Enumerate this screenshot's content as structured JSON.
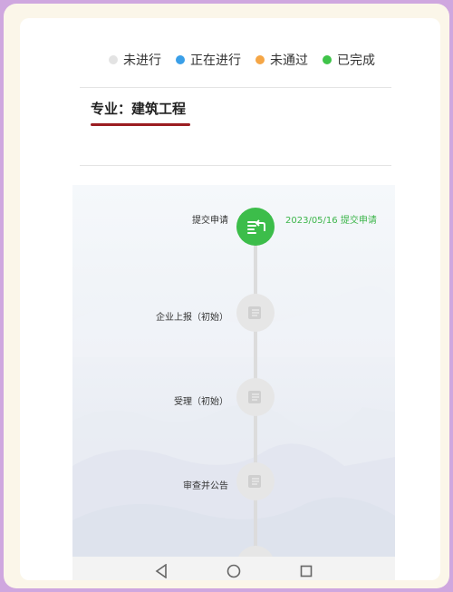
{
  "legend": [
    {
      "label": "未进行",
      "color": "#e3e3e3"
    },
    {
      "label": "正在进行",
      "color": "#3a9fe8"
    },
    {
      "label": "未通过",
      "color": "#f5a646"
    },
    {
      "label": "已完成",
      "color": "#3fc449"
    }
  ],
  "header": {
    "major": "专业：建筑工程"
  },
  "timeline": {
    "steps": [
      {
        "label": "提交申请",
        "status": "done",
        "status_text": "2023/05/16 提交申请",
        "icon": "submit-document-icon"
      },
      {
        "label": "企业上报（初始）",
        "status": "pending",
        "status_text": "",
        "icon": "report-document-icon"
      },
      {
        "label": "受理（初始）",
        "status": "pending",
        "status_text": "",
        "icon": "accept-document-icon"
      },
      {
        "label": "审查并公告",
        "status": "pending",
        "status_text": "",
        "icon": "review-document-icon"
      },
      {
        "label": "",
        "status": "pending",
        "status_text": "",
        "icon": "checkmark-icon"
      }
    ]
  },
  "navbar": {
    "buttons": [
      "back-icon",
      "home-icon",
      "recents-icon"
    ]
  }
}
